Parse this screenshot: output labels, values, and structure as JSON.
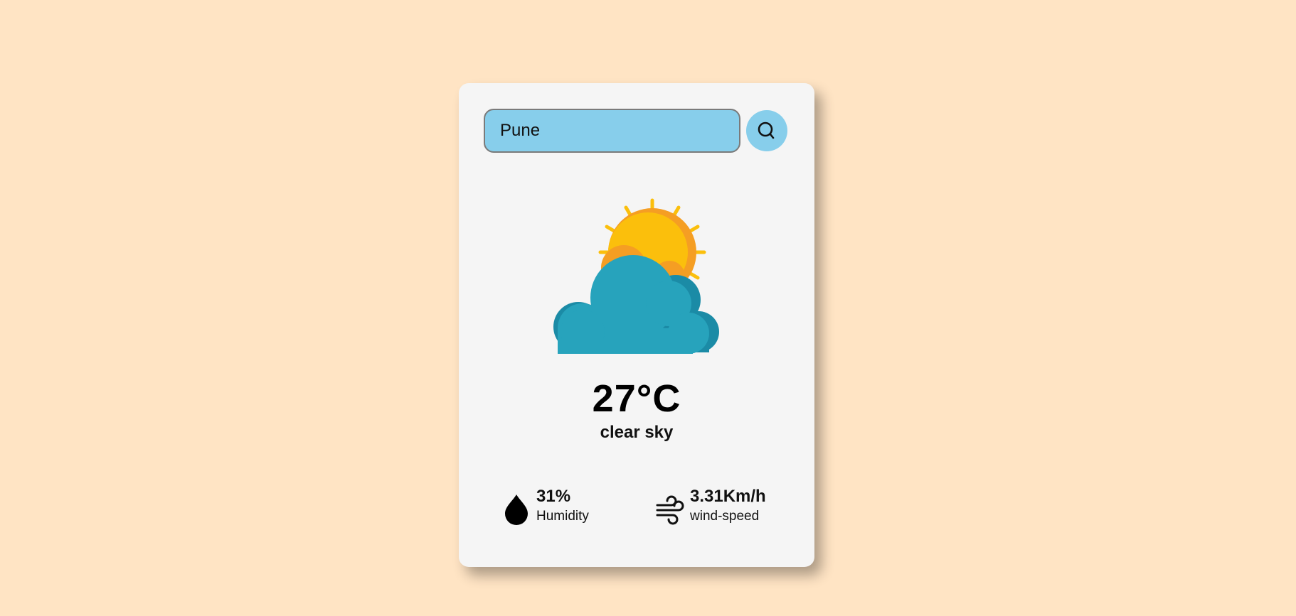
{
  "search": {
    "value": "Pune",
    "button_icon": "search-icon"
  },
  "weather": {
    "icon": "partly-cloudy-sun-icon",
    "temperature": "27°C",
    "description": "clear sky"
  },
  "stats": {
    "humidity": {
      "icon": "water-drop-icon",
      "value": "31%",
      "label": "Humidity"
    },
    "wind": {
      "icon": "wind-icon",
      "value": "3.31Km/h",
      "label": "wind-speed"
    }
  },
  "colors": {
    "page_background": "#ffe4c4",
    "card_background": "#f5f5f5",
    "accent": "#87ceeb",
    "sun": "#fbbf0c",
    "sun_shade": "#f59e23",
    "cloud": "#27a3bc",
    "cloud_shade": "#1b8ba6"
  }
}
